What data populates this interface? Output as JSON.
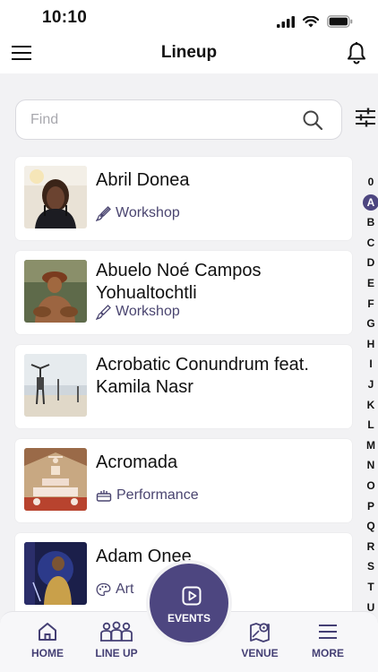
{
  "status_bar": {
    "time": "10:10"
  },
  "header": {
    "title": "Lineup"
  },
  "search": {
    "placeholder": "Find"
  },
  "alphabet": [
    "0",
    "A",
    "B",
    "C",
    "D",
    "E",
    "F",
    "G",
    "H",
    "I",
    "J",
    "K",
    "L",
    "M",
    "N",
    "O",
    "P",
    "Q",
    "R",
    "S",
    "T",
    "U"
  ],
  "alphabet_active": "A",
  "lineup": [
    {
      "name": "Abril Donea",
      "category": "Workshop",
      "category_icon": "brush-icon"
    },
    {
      "name": "Abuelo Noé Campos Yohualtochtli",
      "category": "Workshop",
      "category_icon": "brush-icon"
    },
    {
      "name": "Acrobatic Conundrum feat. Kamila Nasr",
      "category": "",
      "category_icon": ""
    },
    {
      "name": "Acromada",
      "category": "Performance",
      "category_icon": "stage-icon"
    },
    {
      "name": "Adam Onee",
      "category": "Art",
      "category_icon": "palette-icon"
    }
  ],
  "bottom_nav": {
    "home": "HOME",
    "lineup": "LINE UP",
    "events": "EVENTS",
    "venue": "VENUE",
    "more": "MORE"
  },
  "colors": {
    "accent": "#4d4680",
    "category_text": "#4a4570"
  }
}
